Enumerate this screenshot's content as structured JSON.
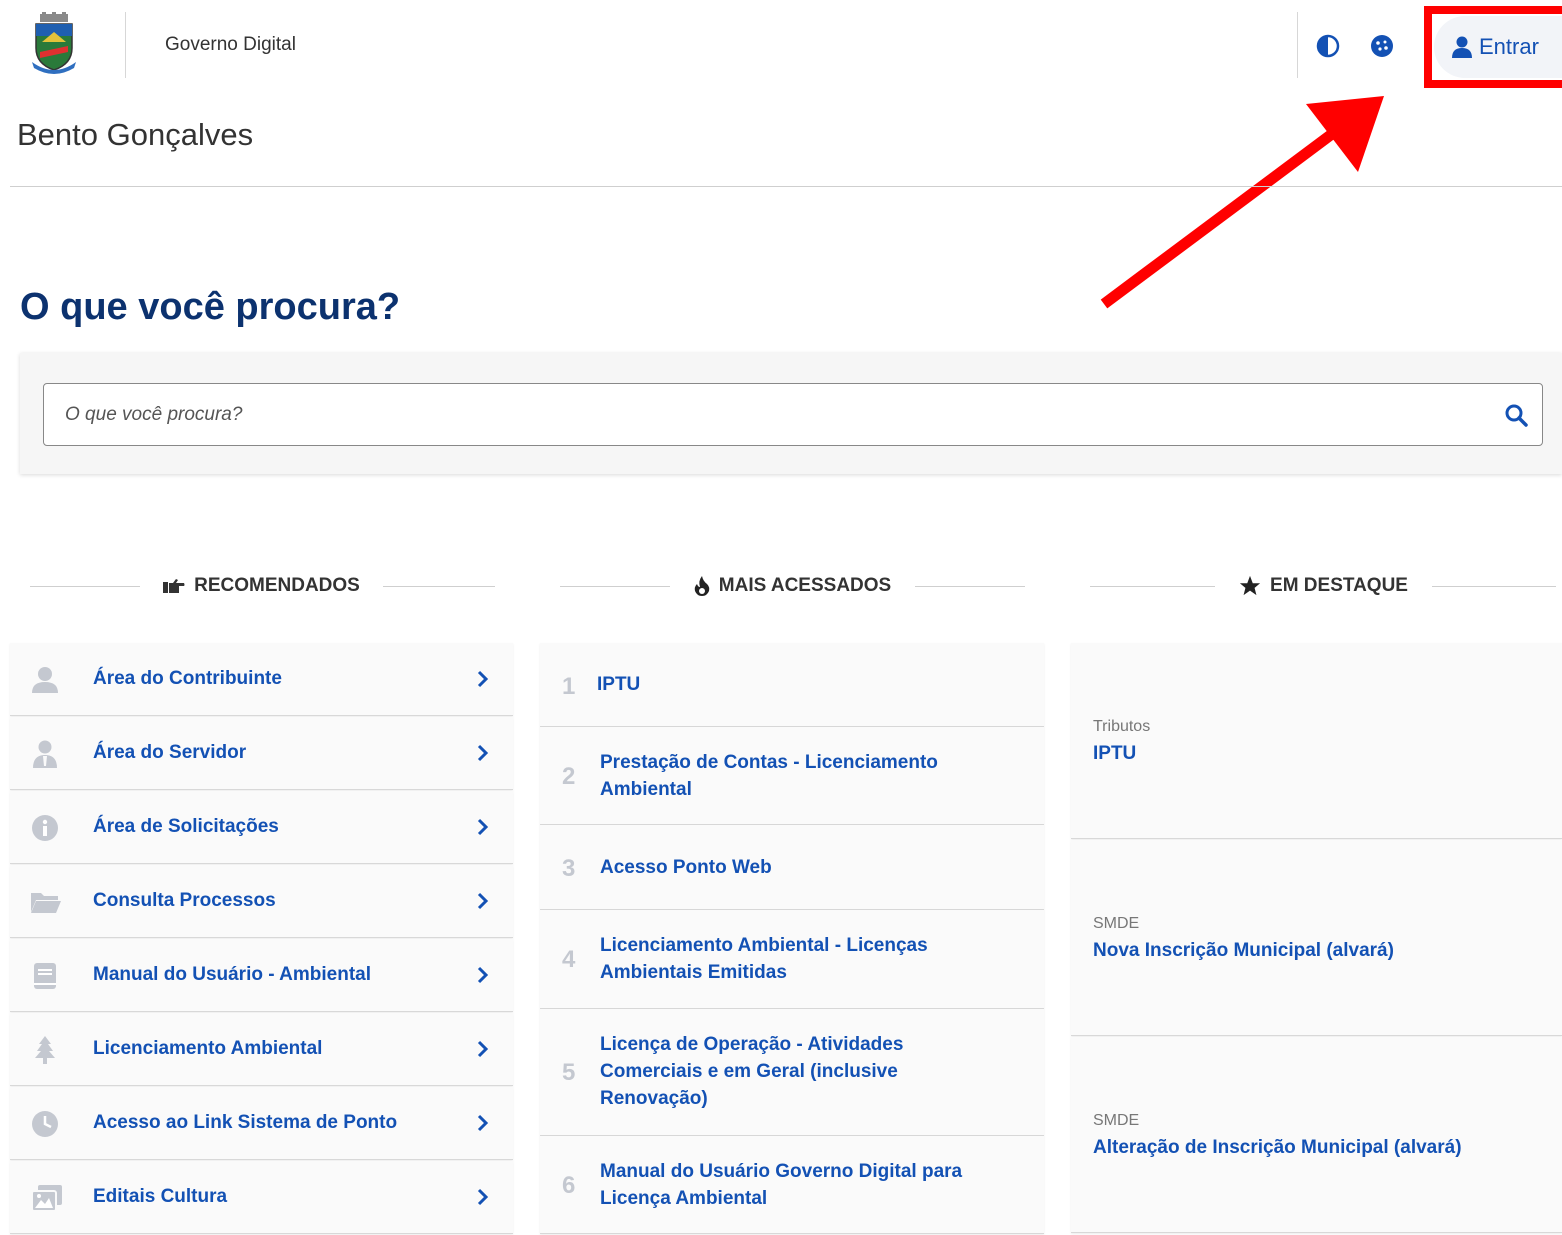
{
  "header": {
    "site_name": "Governo Digital",
    "login_label": "Entrar",
    "contrast_icon": "contrast-icon",
    "accessibility_icon": "cookie-icon"
  },
  "city_name": "Bento Gonçalves",
  "search": {
    "title": "O que você procura?",
    "placeholder": "O que você procura?"
  },
  "sections": {
    "recommended": "RECOMENDADOS",
    "most_accessed": "MAIS ACESSADOS",
    "featured": "EM DESTAQUE"
  },
  "recommended": [
    {
      "label": "Área do Contribuinte",
      "icon": "user-icon"
    },
    {
      "label": "Área do Servidor",
      "icon": "user-tie-icon"
    },
    {
      "label": "Área de Solicitações",
      "icon": "info-icon"
    },
    {
      "label": "Consulta Processos",
      "icon": "folder-icon"
    },
    {
      "label": "Manual do Usuário - Ambiental",
      "icon": "book-icon"
    },
    {
      "label": "Licenciamento Ambiental",
      "icon": "tree-icon"
    },
    {
      "label": "Acesso ao Link Sistema de Ponto",
      "icon": "clock-icon"
    },
    {
      "label": "Editais Cultura",
      "icon": "images-icon"
    }
  ],
  "most_accessed": [
    {
      "num": "1",
      "label": "IPTU"
    },
    {
      "num": "2",
      "label": "Prestação de Contas - Licenciamento Ambiental"
    },
    {
      "num": "3",
      "label": "Acesso Ponto Web"
    },
    {
      "num": "4",
      "label": "Licenciamento Ambiental - Licenças Ambientais Emitidas"
    },
    {
      "num": "5",
      "label": "Licença de Operação - Atividades Comerciais e em Geral (inclusive Renovação)"
    },
    {
      "num": "6",
      "label": "Manual do Usuário Governo Digital para Licença Ambiental"
    }
  ],
  "featured": [
    {
      "category": "Tributos",
      "label": "IPTU"
    },
    {
      "category": "SMDE",
      "label": "Nova Inscrição Municipal (alvará)"
    },
    {
      "category": "SMDE",
      "label": "Alteração de Inscrição Municipal (alvará)"
    }
  ],
  "colors": {
    "primary": "#1351b4",
    "title": "#0c326f",
    "highlight": "#ff0000"
  }
}
